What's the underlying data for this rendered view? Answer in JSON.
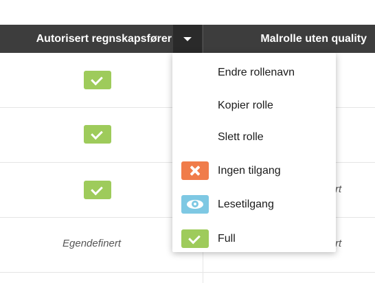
{
  "header": {
    "col1_title": "Autorisert regnskapsfører",
    "col2_title": "Malrolle uten quality"
  },
  "rows": [
    {
      "col1": "check"
    },
    {
      "col1": "check"
    },
    {
      "col1": "check",
      "col2_partial": "rt"
    },
    {
      "col1": "Egendefinert",
      "col2_partial": "rt"
    }
  ],
  "dropdown_menu": {
    "items": [
      {
        "label": "Endre rollenavn",
        "icon": null
      },
      {
        "label": "Kopier rolle",
        "icon": null
      },
      {
        "label": "Slett rolle",
        "icon": null
      },
      {
        "label": "Ingen tilgang",
        "icon": "x-icon",
        "color": "#f07c4a"
      },
      {
        "label": "Lesetilgang",
        "icon": "eye-icon",
        "color": "#7ec8e3"
      },
      {
        "label": "Full",
        "icon": "check-icon",
        "color": "#9ecb5b"
      }
    ]
  },
  "colors": {
    "header_bg": "#3d3d3d",
    "toggle_bg": "#2a2a2a",
    "check_green": "#9ecb5b"
  }
}
